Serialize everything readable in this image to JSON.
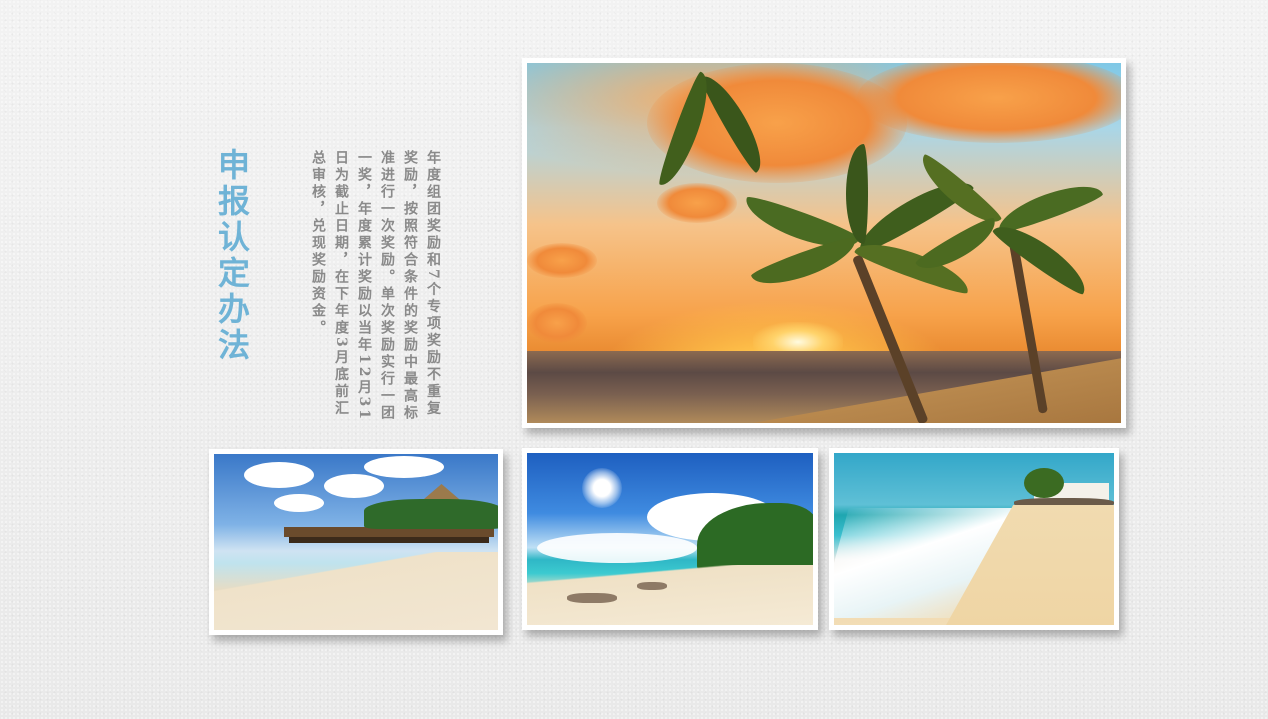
{
  "slide": {
    "title": "申报认定办法",
    "body": "年度组团奖励和7个专项奖励不重复奖励，按照符合条件的奖励中最高标准进行一次奖励。单次奖励实行一团一奖，年度累计奖励以当年12月31日为截止日期，在下年度3月底前汇总审核，兑现奖励资金。"
  },
  "photos": [
    {
      "name": "main-sunset-photo",
      "subject": "sunset beach with palm trees"
    },
    {
      "name": "thatched-hut-pier-photo",
      "subject": "beach pier with thatched huts"
    },
    {
      "name": "sunny-beach-photo",
      "subject": "sunny beach with palms"
    },
    {
      "name": "wave-beach-photo",
      "subject": "waves on sandy beach"
    }
  ],
  "colors": {
    "title": "#6fb3d6",
    "body_text": "#8a8a8a",
    "background": "#ececec",
    "frame": "#ffffff"
  }
}
